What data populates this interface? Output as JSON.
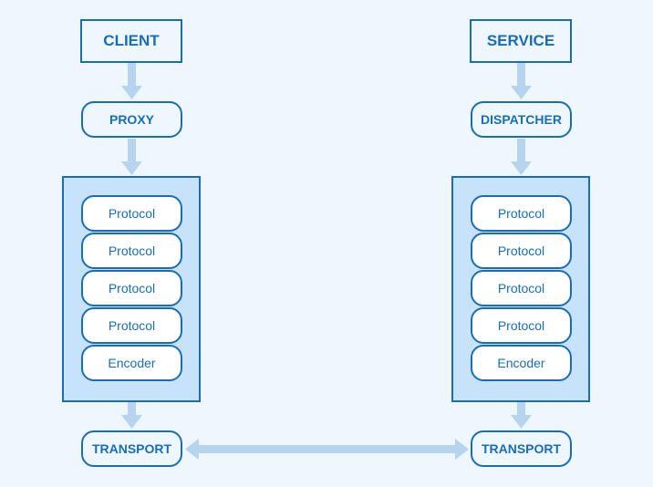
{
  "colors": {
    "background": "#eef6fe",
    "border": "#1a6db5",
    "stack_fill": "#c7e3fb",
    "arrow": "#b6d4ee"
  },
  "client": {
    "title": "CLIENT",
    "proxy": "PROXY",
    "layers": [
      "Protocol",
      "Protocol",
      "Protocol",
      "Protocol",
      "Encoder"
    ],
    "transport": "TRANSPORT"
  },
  "service": {
    "title": "SERVICE",
    "dispatcher": "DISPATCHER",
    "layers": [
      "Protocol",
      "Protocol",
      "Protocol",
      "Protocol",
      "Encoder"
    ],
    "transport": "TRANSPORT"
  }
}
